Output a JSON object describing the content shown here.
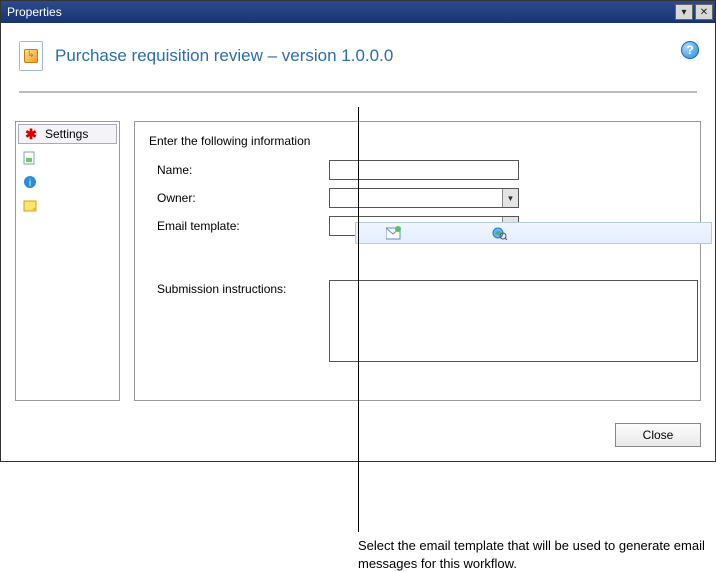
{
  "titlebar": {
    "title": "Properties"
  },
  "header": {
    "heading": "Purchase requisition review – version 1.0.0.0"
  },
  "nav": {
    "items": [
      {
        "label": "Settings",
        "icon": "asterisk",
        "selected": true
      },
      {
        "label": "",
        "icon": "doc-green"
      },
      {
        "label": "",
        "icon": "info-blue"
      },
      {
        "label": "",
        "icon": "note-yellow"
      }
    ]
  },
  "form": {
    "prompt": "Enter the following information",
    "name_label": "Name:",
    "name_value": "",
    "owner_label": "Owner:",
    "owner_value": "",
    "email_template_label": "Email template:",
    "email_template_value": "",
    "submission_label": "Submission instructions:",
    "submission_value": ""
  },
  "footer": {
    "close_label": "Close"
  },
  "callout": {
    "text": "Select the email template that will be used to generate email messages for this workflow."
  }
}
